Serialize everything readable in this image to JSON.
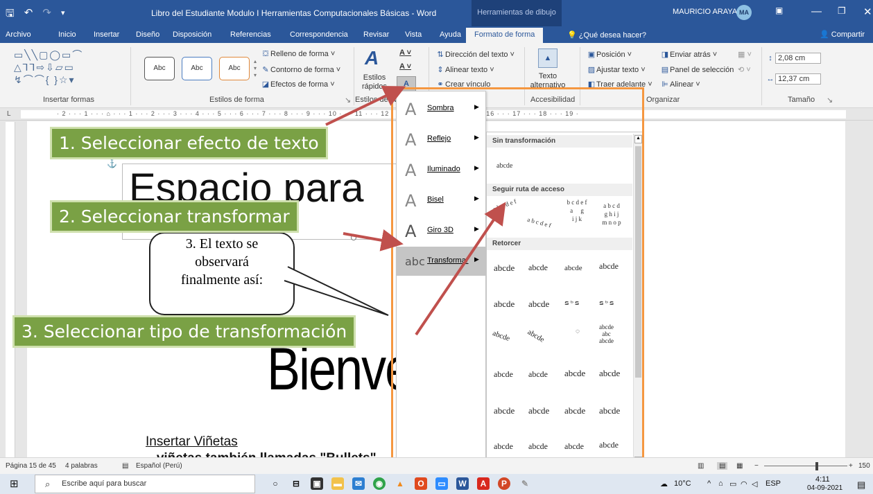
{
  "titlebar": {
    "title": "Libro del Estudiante Modulo I Herramientas Computacionales Básicas  -  Word",
    "context_tab": "Herramientas de dibujo",
    "user": "MAURICIO ARAYA",
    "initials": "MA"
  },
  "tabs": [
    {
      "label": "Archivo"
    },
    {
      "label": "Inicio"
    },
    {
      "label": "Insertar"
    },
    {
      "label": "Diseño"
    },
    {
      "label": "Disposición"
    },
    {
      "label": "Referencias"
    },
    {
      "label": "Correspondencia"
    },
    {
      "label": "Revisar"
    },
    {
      "label": "Vista"
    },
    {
      "label": "Ayuda"
    },
    {
      "label": "Formato de forma"
    }
  ],
  "tell_me": "¿Qué desea hacer?",
  "share": "Compartir",
  "ribbon": {
    "groups": {
      "insert_shapes": "Insertar formas",
      "shape_styles": "Estilos de forma",
      "wordart_styles": "Estilos de WordArt",
      "accessibility": "Accesibilidad",
      "arrange": "Organizar",
      "size": "Tamaño"
    },
    "style_sample": "Abc",
    "fill": "Relleno de forma",
    "outline": "Contorno de forma",
    "effects": "Efectos de forma",
    "quick_styles": [
      "Estilos",
      "rápidos"
    ],
    "text_direction": "Dirección del texto",
    "align_text": "Alinear texto",
    "create_link": "Crear vínculo",
    "alt_text": [
      "Texto",
      "alternativo"
    ],
    "position": "Posición",
    "wrap_text": "Ajustar texto",
    "bring_forward": "Traer adelante",
    "send_backward": "Enviar atrás",
    "selection_pane": "Panel de selección",
    "align": "Alinear",
    "height": "2,08 cm",
    "width": "12,37 cm"
  },
  "document": {
    "heading": "Espacio para",
    "callout_lines": [
      "3. El texto se",
      "observará",
      "finalmente así:"
    ],
    "wordart": "Bienvenidos",
    "insert_bullets": "Insertar Viñetas",
    "bottom_text": "...viñetas también llamadas \"Bullets\"..."
  },
  "effects_menu": [
    {
      "label": "Sombra",
      "icon": "shadow-icon"
    },
    {
      "label": "Reflejo",
      "icon": "reflection-icon"
    },
    {
      "label": "Iluminado",
      "icon": "glow-icon"
    },
    {
      "label": "Bisel",
      "icon": "bevel-icon"
    },
    {
      "label": "Giro 3D",
      "icon": "rotation-3d-icon"
    },
    {
      "label": "Transformar",
      "icon": "transform-icon"
    }
  ],
  "transform_gallery": {
    "no_transform_header": "Sin transformación",
    "no_transform_sample": "abcde",
    "follow_path_header": "Seguir ruta de acceso",
    "warp_header": "Retorcer",
    "sample": "abcde"
  },
  "steps": [
    "1. Seleccionar efecto de texto",
    "2. Seleccionar transformar",
    "3. Seleccionar tipo de transformación"
  ],
  "statusbar": {
    "page": "Página 15 de 45",
    "words": "4 palabras",
    "language": "Español (Perú)",
    "zoom": "150"
  },
  "taskbar": {
    "search_placeholder": "Escribe aquí para buscar",
    "temperature": "10°C",
    "lang": "ESP",
    "time": "4:11",
    "date": "04-09-2021"
  },
  "colors": {
    "word_blue": "#2b579a",
    "step_green": "#7aa145",
    "highlight_orange": "#f59740",
    "arrow_red": "#c0504d"
  }
}
